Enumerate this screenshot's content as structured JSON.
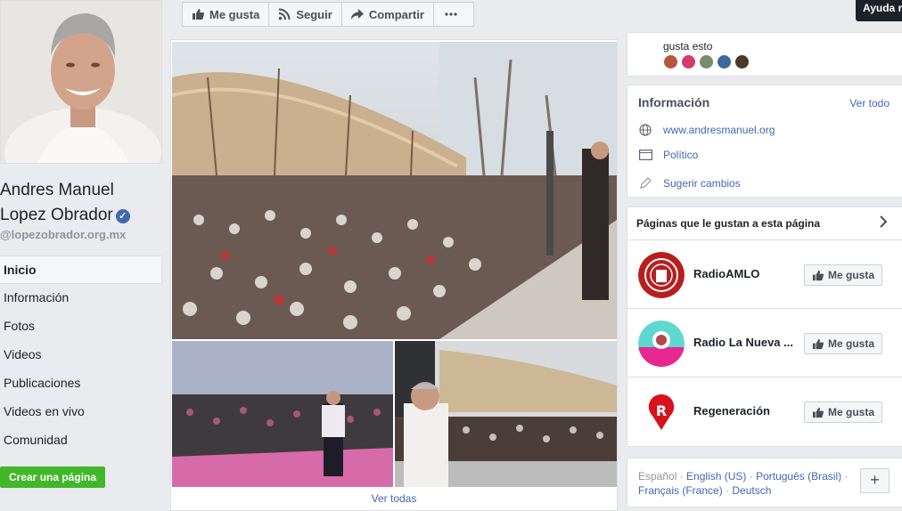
{
  "profile": {
    "name_line1": "Andres Manuel",
    "name_line2": "Lopez Obrador",
    "username": "@lopezobrador.org.mx"
  },
  "nav": {
    "items": [
      {
        "label": "Inicio",
        "active": true
      },
      {
        "label": "Información"
      },
      {
        "label": "Fotos"
      },
      {
        "label": "Videos"
      },
      {
        "label": "Publicaciones"
      },
      {
        "label": "Videos en vivo"
      },
      {
        "label": "Comunidad"
      }
    ],
    "create_page": "Crear una página"
  },
  "actions": {
    "like": "Me gusta",
    "follow": "Seguir",
    "share": "Compartir"
  },
  "tooltip": "Ayuda r",
  "photos": {
    "see_all": "Ver todas"
  },
  "likes_card": {
    "text": "gusta esto"
  },
  "info": {
    "title": "Información",
    "see_all": "Ver todo",
    "website": "www.andresmanuel.org",
    "category": "Político",
    "suggest": "Sugerir cambios"
  },
  "liked_pages": {
    "title": "Páginas que le gustan a esta página",
    "like_label": "Me gusta",
    "items": [
      {
        "name": "RadioAMLO"
      },
      {
        "name": "Radio La Nueva ..."
      },
      {
        "name": "Regeneración"
      }
    ]
  },
  "languages": {
    "current": "Español",
    "options": [
      "English (US)",
      "Português (Brasil)",
      "Français (France)",
      "Deutsch"
    ],
    "add": "+"
  }
}
